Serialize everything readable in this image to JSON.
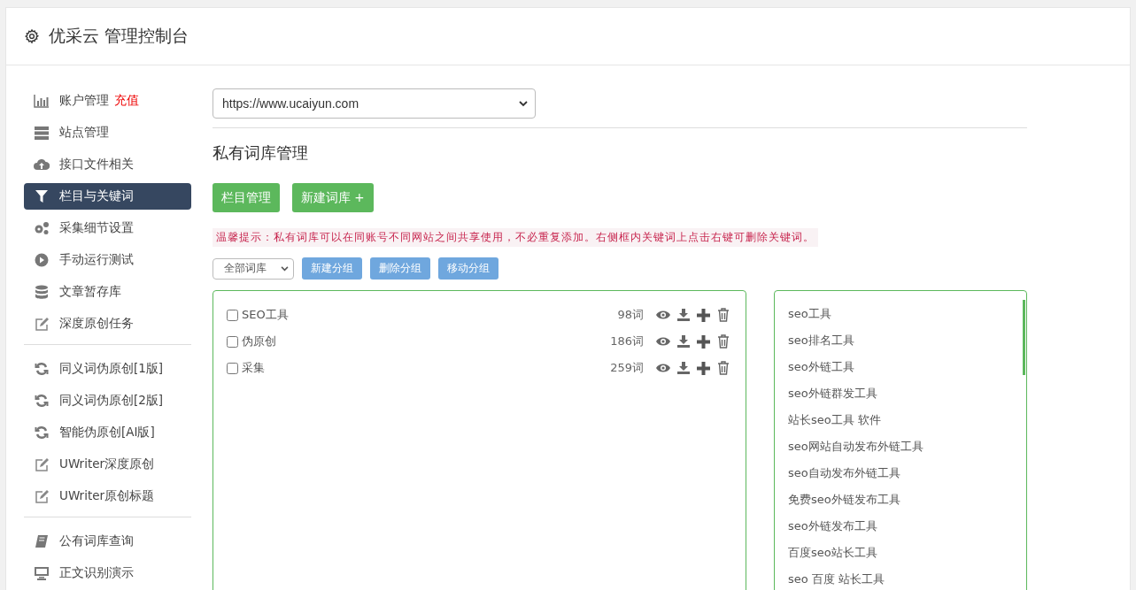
{
  "header": {
    "title": "优采云 管理控制台"
  },
  "sidebar": {
    "groups": [
      [
        {
          "label": "账户管理",
          "badge": "充值",
          "selected": false
        },
        {
          "label": "站点管理",
          "selected": false
        },
        {
          "label": "接口文件相关",
          "selected": false
        },
        {
          "label": "栏目与关键词",
          "selected": true
        },
        {
          "label": "采集细节设置",
          "selected": false
        },
        {
          "label": "手动运行测试",
          "selected": false
        },
        {
          "label": "文章暂存库",
          "selected": false
        },
        {
          "label": "深度原创任务",
          "selected": false
        }
      ],
      [
        {
          "label": "同义词伪原创[1版]",
          "selected": false
        },
        {
          "label": "同义词伪原创[2版]",
          "selected": false
        },
        {
          "label": "智能伪原创[AI版]",
          "selected": false
        },
        {
          "label": "UWriter深度原创",
          "selected": false
        },
        {
          "label": "UWriter原创标题",
          "selected": false
        }
      ],
      [
        {
          "label": "公有词库查询",
          "selected": false
        },
        {
          "label": "正文识别演示",
          "selected": false
        }
      ]
    ]
  },
  "main": {
    "site_select": {
      "value": "https://www.ucaiyun.com"
    },
    "heading": "私有词库管理",
    "buttons": [
      "栏目管理",
      "新建词库 +"
    ],
    "tip": "温馨提示：私有词库可以在同账号不同网站之间共享使用，不必重复添加。右侧框内关键词上点击右键可删除关键词。",
    "group_select": {
      "value": "全部词库"
    },
    "group_buttons": [
      "新建分组",
      "删除分组",
      "移动分组"
    ],
    "libraries": [
      {
        "name": "SEO工具",
        "checked": false,
        "count": "98词"
      },
      {
        "name": "伪原创",
        "checked": false,
        "count": "186词"
      },
      {
        "name": "采集",
        "checked": false,
        "count": "259词"
      }
    ],
    "keywords": [
      "seo工具",
      "seo排名工具",
      "seo外链工具",
      "seo外链群发工具",
      "站长seo工具 软件",
      "seo网站自动发布外链工具",
      "seo自动发布外链工具",
      "免费seo外链发布工具",
      "seo外链发布工具",
      "百度seo站长工具",
      "seo 百度 站长工具"
    ]
  }
}
